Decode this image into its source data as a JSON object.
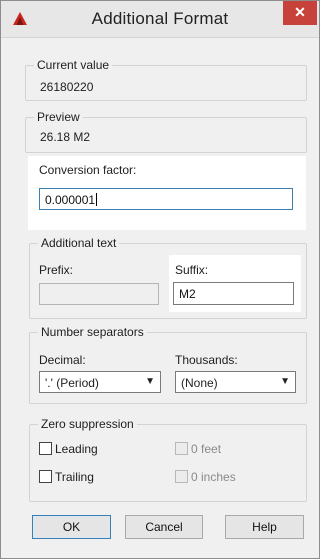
{
  "window": {
    "title": "Additional Format",
    "close_symbol": "✕",
    "app_icon": "autocad-logo-icon",
    "accent": "#c7423a",
    "highlight": "#ffffff",
    "focus_border": "#3c7fb1"
  },
  "current_value": {
    "label": "Current value",
    "value": "26180220"
  },
  "preview": {
    "label": "Preview",
    "value": "26.18 M2"
  },
  "conversion": {
    "label": "Conversion factor:",
    "value": "0.000001"
  },
  "additional_text": {
    "label": "Additional text",
    "prefix_label": "Prefix:",
    "prefix_value": "",
    "suffix_label": "Suffix:",
    "suffix_value": "M2"
  },
  "number_separators": {
    "label": "Number separators",
    "decimal_label": "Decimal:",
    "decimal_value": "'.' (Period)",
    "thousands_label": "Thousands:",
    "thousands_value": "(None)"
  },
  "zero_suppression": {
    "label": "Zero suppression",
    "leading": "Leading",
    "trailing": "Trailing",
    "zero_feet": "0 feet",
    "zero_inches": "0 inches"
  },
  "buttons": {
    "ok": "OK",
    "cancel": "Cancel",
    "help": "Help"
  }
}
